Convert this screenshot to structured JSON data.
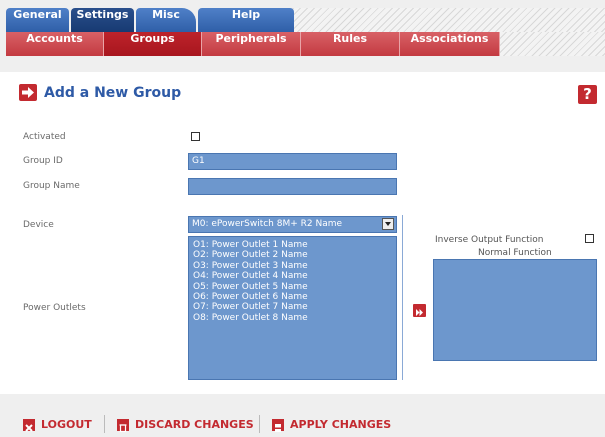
{
  "top_tabs": [
    {
      "label": "General"
    },
    {
      "label": "Settings"
    },
    {
      "label": "Misc"
    },
    {
      "label": "Help"
    }
  ],
  "sub_tabs": [
    {
      "label": "Accounts"
    },
    {
      "label": "Groups"
    },
    {
      "label": "Peripherals"
    },
    {
      "label": "Rules"
    },
    {
      "label": "Associations"
    }
  ],
  "page": {
    "title": "Add a New Group",
    "help_icon": "?"
  },
  "form": {
    "activated_label": "Activated",
    "group_id_label": "Group ID",
    "group_id_value": "G1",
    "group_name_label": "Group Name",
    "group_name_value": "",
    "device_label": "Device",
    "device_selected": "M0: ePowerSwitch 8M+ R2 Name",
    "power_outlets_label": "Power Outlets",
    "outlets": [
      "O1: Power Outlet 1 Name",
      "O2: Power Outlet 2 Name",
      "O3: Power Outlet 3 Name",
      "O4: Power Outlet 4 Name",
      "O5: Power Outlet 5 Name",
      "O6: Power Outlet 6 Name",
      "O7: Power Outlet 7 Name",
      "O8: Power Outlet 8 Name"
    ],
    "inverse_label": "Inverse Output Function",
    "normal_label": "Normal Function"
  },
  "actions": {
    "logout": "LOGOUT",
    "discard": "DISCARD CHANGES",
    "apply": "APPLY CHANGES"
  },
  "colors": {
    "brand_blue": "#2e5aa6",
    "brand_red": "#c32a30",
    "field_blue": "#6d97cd"
  }
}
